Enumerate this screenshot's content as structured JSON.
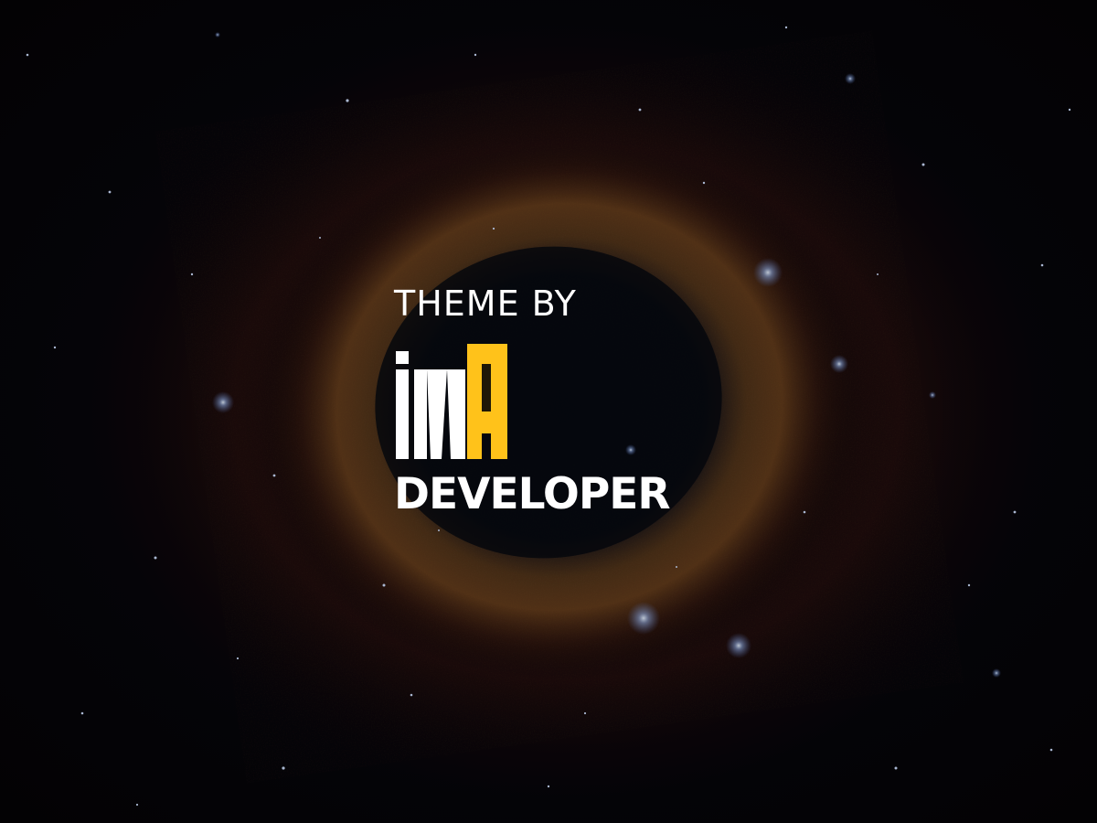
{
  "background": {
    "scene": "helix-nebula-starfield",
    "ring_color": "#b8772a",
    "core_color": "#0a0e1c",
    "star_color": "#cfe0ff"
  },
  "brand": {
    "theme_by": "THEME BY",
    "logo": {
      "mark": "iMA",
      "word": "DEVELOPER",
      "accent_color": "#ffc21a",
      "text_color": "#ffffff"
    }
  }
}
